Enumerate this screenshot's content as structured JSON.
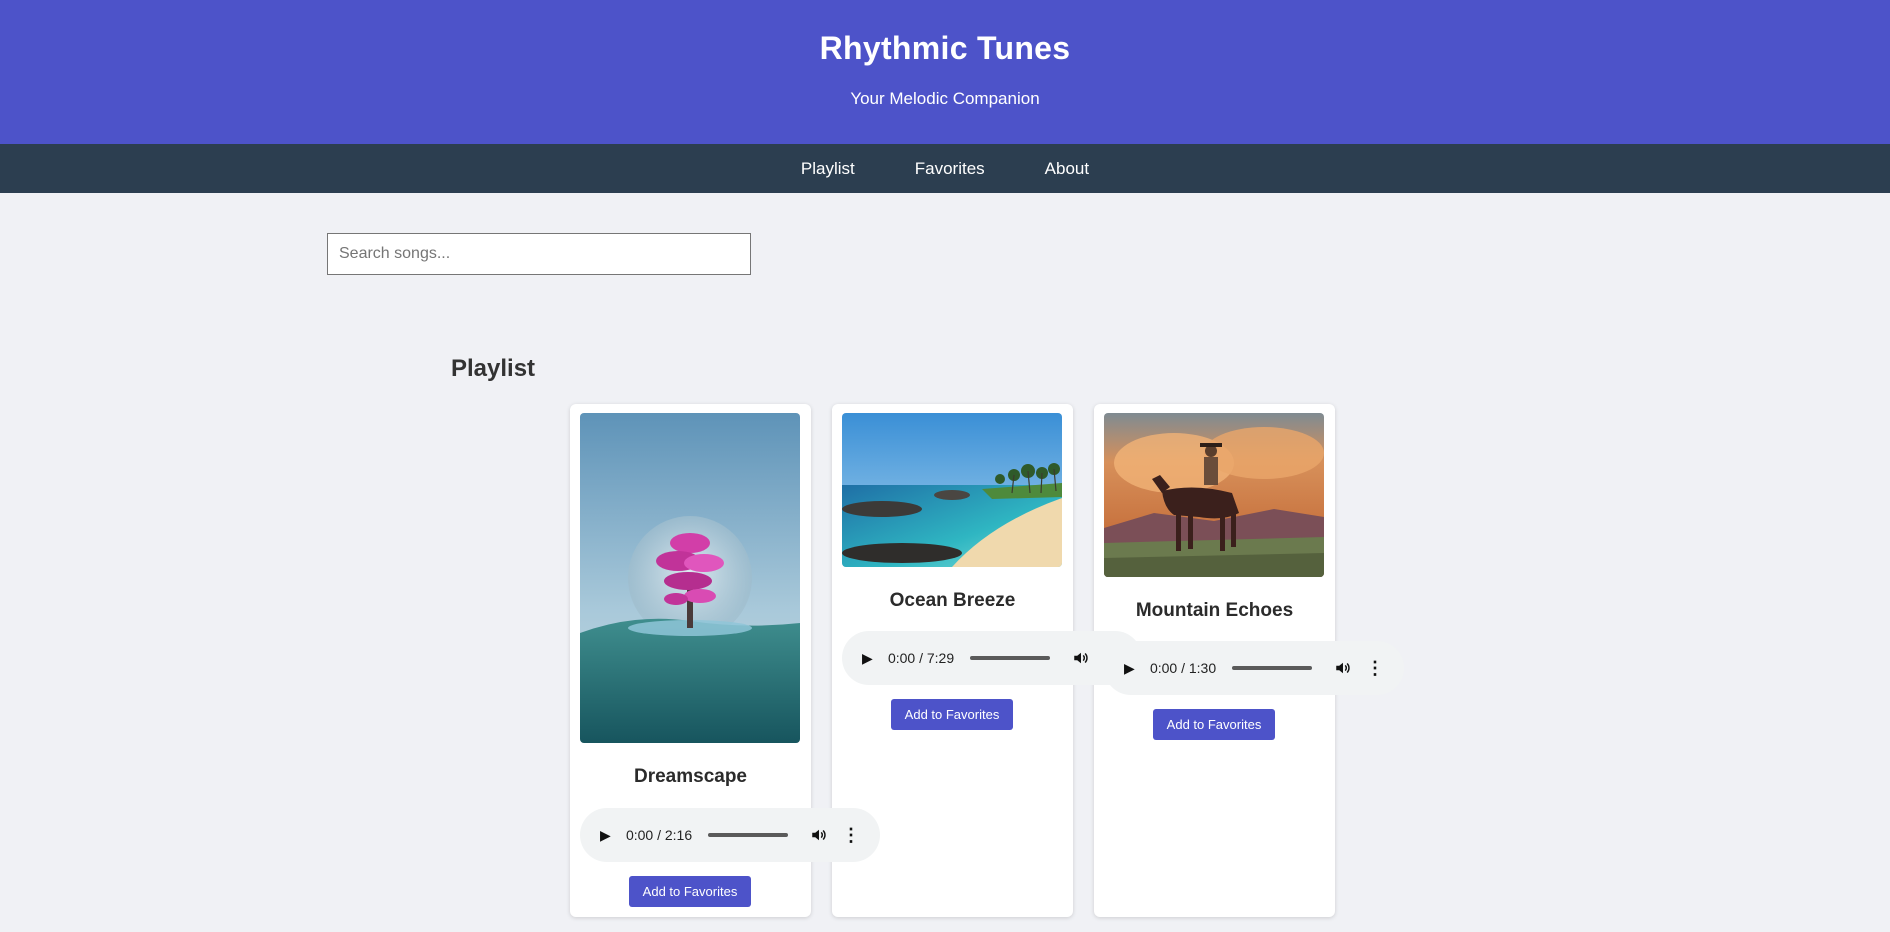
{
  "header": {
    "title": "Rhythmic Tunes",
    "subtitle": "Your Melodic Companion"
  },
  "nav": {
    "items": [
      {
        "label": "Playlist"
      },
      {
        "label": "Favorites"
      },
      {
        "label": "About"
      }
    ]
  },
  "search": {
    "placeholder": "Search songs...",
    "value": ""
  },
  "playlist": {
    "title": "Playlist",
    "songs": [
      {
        "title": "Dreamscape",
        "image": "pink-tree-moon-art",
        "current_time": "0:00",
        "duration": "2:16",
        "time_display": "0:00 / 2:16",
        "progress": 0,
        "fav_label": "Add to Favorites"
      },
      {
        "title": "Ocean Breeze",
        "image": "tropical-beach-photo",
        "current_time": "0:00",
        "duration": "7:29",
        "time_display": "0:00 / 7:29",
        "progress": 0,
        "fav_label": "Add to Favorites"
      },
      {
        "title": "Mountain Echoes",
        "image": "cowboy-on-horse-painting",
        "current_time": "0:00",
        "duration": "1:30",
        "time_display": "0:00 / 1:30",
        "progress": 0,
        "fav_label": "Add to Favorites"
      }
    ]
  },
  "icons": {
    "play": "play-icon",
    "volume": "volume-icon",
    "more": "more-options-icon"
  },
  "colors": {
    "header_bg": "#4d53c9",
    "nav_bg": "#2c3e50",
    "page_bg": "#f0f1f5",
    "button_bg": "#4d53c9"
  }
}
